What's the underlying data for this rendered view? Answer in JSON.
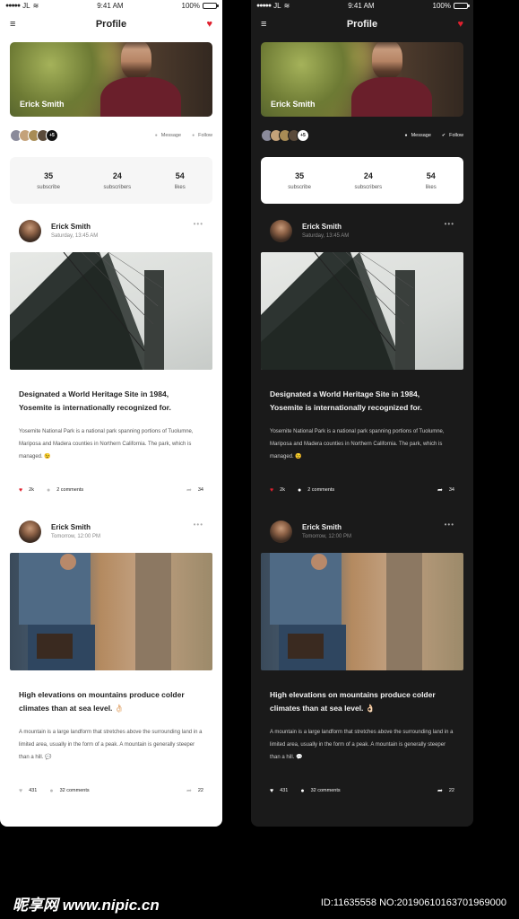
{
  "status": {
    "carrier": "JL",
    "time": "9:41 AM",
    "battery": "100%"
  },
  "navbar": {
    "title": "Profile"
  },
  "profile": {
    "name": "Erick Smith",
    "followers_more": "+5",
    "message_label": "Message",
    "follow_label": "Follow"
  },
  "stats": [
    {
      "value": "35",
      "label": "subscribe"
    },
    {
      "value": "24",
      "label": "subscribers"
    },
    {
      "value": "54",
      "label": "likes"
    }
  ],
  "posts": [
    {
      "author": "Erick Smith",
      "time": "Saturday, 13:45 AM",
      "title": "Designated a World Heritage Site in 1984, Yosemite is internationally recognized for.",
      "text": "Yosemite National Park is a national park spanning portions of Tuolumne, Mariposa and Madera counties in Northern California. The park, which is managed. 😉",
      "likes": "2k",
      "comments": "2 comments",
      "shares": "34"
    },
    {
      "author": "Erick Smith",
      "time": "Tomorrow, 12:00 PM",
      "title": "High elevations on mountains produce colder climates than at sea level. 👌🏻",
      "text": "A mountain is a large landform that stretches above the surrounding land in a limited area, usually in the form of a peak. A mountain is generally steeper than a hill. 💬",
      "likes": "431",
      "comments": "32 comments",
      "shares": "22"
    }
  ],
  "watermark": {
    "logo": "昵享网 www.nipic.cn",
    "id": "ID:11635558 NO:20190610163701969000"
  },
  "colors": {
    "accent_red": "#e0202e",
    "dark_bg": "#1a1a1a",
    "light_bg": "#ffffff"
  }
}
